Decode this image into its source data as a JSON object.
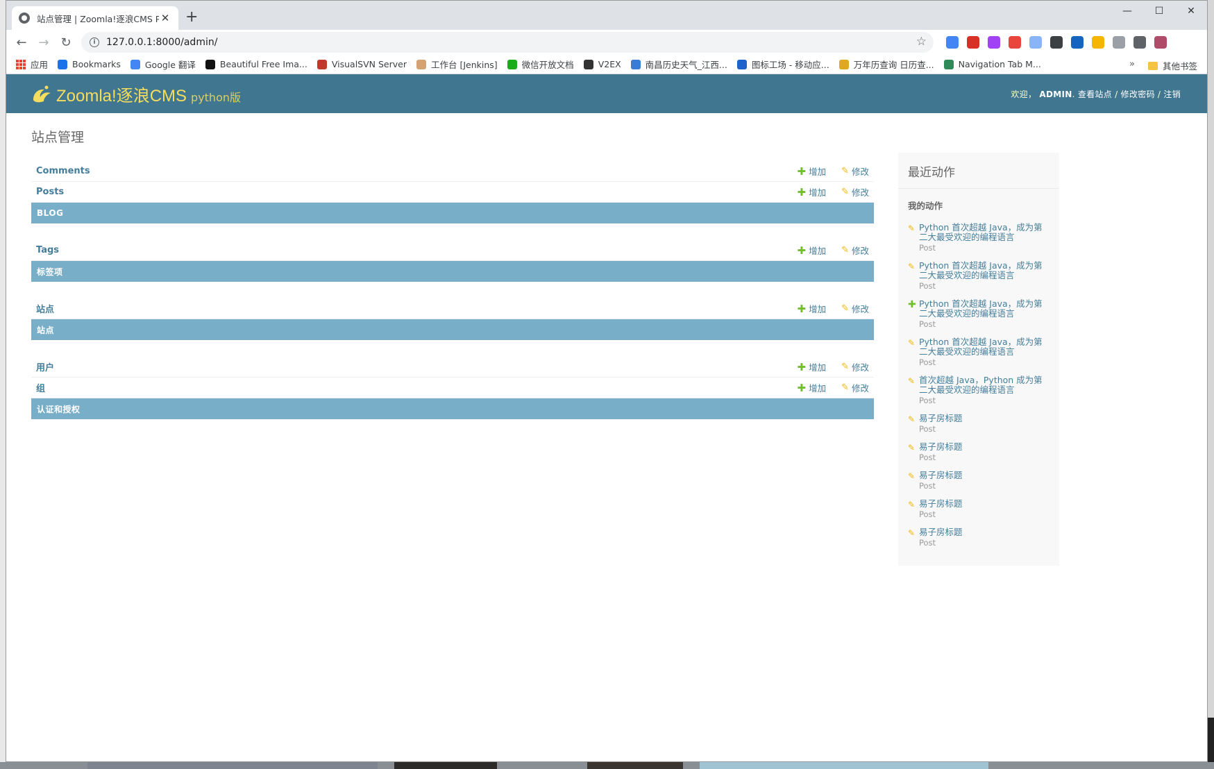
{
  "browser": {
    "tab_title": "站点管理 | Zoomla!逐浪CMS Py",
    "tab_close": "✕",
    "new_tab": "+",
    "window_controls": {
      "minimize": "—",
      "maximize": "☐",
      "close": "✕"
    },
    "nav": {
      "back": "←",
      "forward": "→",
      "reload": "↻"
    },
    "url": "127.0.0.1:8000/admin/",
    "info_icon": "i",
    "star": "☆",
    "extensions": [
      "#4285f4",
      "#d93025",
      "#a142f4",
      "#e8453c",
      "#8ab4f8",
      "#3c4043",
      "#1565c0",
      "#f6b500",
      "#9aa0a6",
      "#5f6368",
      "#b04c6a"
    ]
  },
  "bookmarks": {
    "apps_label": "应用",
    "items": [
      {
        "label": "Bookmarks",
        "icon": "star-icon",
        "color": "#1a73e8"
      },
      {
        "label": "Google 翻译",
        "icon": "google-translate-icon",
        "color": "#4285f4"
      },
      {
        "label": "Beautiful Free Ima...",
        "icon": "unsplash-icon",
        "color": "#111111"
      },
      {
        "label": "VisualSVN Server",
        "icon": "visualsvn-icon",
        "color": "#c0392b"
      },
      {
        "label": "工作台 [Jenkins]",
        "icon": "jenkins-icon",
        "color": "#d4a373"
      },
      {
        "label": "微信开放文档",
        "icon": "wechat-icon",
        "color": "#1aad19"
      },
      {
        "label": "V2EX",
        "icon": "v2ex-icon",
        "color": "#333333"
      },
      {
        "label": "南昌历史天气_江西...",
        "icon": "weather-icon",
        "color": "#3a7bd5"
      },
      {
        "label": "图标工场 - 移动应...",
        "icon": "rh-icon",
        "color": "#1e63c9"
      },
      {
        "label": "万年历查询 日历查...",
        "icon": "calendar-icon",
        "color": "#e0a81e"
      },
      {
        "label": "Navigation Tab M...",
        "icon": "navigation-tab-icon",
        "color": "#2e8b57"
      }
    ],
    "more": "»",
    "other_label": "其他书签"
  },
  "admin": {
    "brand_name": "Zoomla!逐浪CMS",
    "brand_sub": "python版",
    "welcome": "欢迎，",
    "username": "ADMIN",
    "view_site": "查看站点",
    "change_password": "修改密码",
    "logout": "注销",
    "separator": " / ",
    "accent": "#417690",
    "caption_color": "#79aec8"
  },
  "page_title": "站点管理",
  "modules": [
    {
      "caption": "BLOG",
      "models": [
        {
          "name": "Comments"
        },
        {
          "name": "Posts"
        }
      ]
    },
    {
      "caption": "标签项",
      "models": [
        {
          "name": "Tags"
        }
      ]
    },
    {
      "caption": "站点",
      "models": [
        {
          "name": "站点"
        }
      ]
    },
    {
      "caption": "认证和授权",
      "models": [
        {
          "name": "用户"
        },
        {
          "name": "组"
        }
      ]
    }
  ],
  "actions": {
    "add": "增加",
    "change": "修改",
    "add_glyph": "✚",
    "change_glyph": "✎"
  },
  "recent": {
    "title": "最近动作",
    "my_actions": "我的动作",
    "items": [
      {
        "kind": "change",
        "text": "Python 首次超越 Java，成为第二大最受欢迎的编程语言",
        "type": "Post"
      },
      {
        "kind": "change",
        "text": "Python 首次超越 Java，成为第二大最受欢迎的编程语言",
        "type": "Post"
      },
      {
        "kind": "add",
        "text": "Python 首次超越 Java，成为第二大最受欢迎的编程语言",
        "type": "Post"
      },
      {
        "kind": "change",
        "text": "Python 首次超越 Java，成为第二大最受欢迎的编程语言",
        "type": "Post"
      },
      {
        "kind": "change",
        "text": "首次超越 Java，Python 成为第二大最受欢迎的编程语言",
        "type": "Post"
      },
      {
        "kind": "change",
        "text": "易子房标题",
        "type": "Post"
      },
      {
        "kind": "change",
        "text": "易子房标题",
        "type": "Post"
      },
      {
        "kind": "change",
        "text": "易子房标题",
        "type": "Post"
      },
      {
        "kind": "change",
        "text": "易子房标题",
        "type": "Post"
      },
      {
        "kind": "change",
        "text": "易子房标题",
        "type": "Post"
      }
    ]
  }
}
